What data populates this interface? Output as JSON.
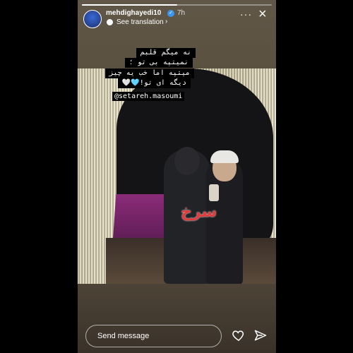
{
  "story": {
    "progress": 0.5,
    "username": "mehdighayedi10",
    "verified_mark": "✓",
    "time": "7h",
    "translation_label": "See translation",
    "translation_chevron": "›",
    "more_icon": "more-icon",
    "close_icon": "×"
  },
  "caption": {
    "lines": [
      "نه میگم قلبم",
      "نمیتپه بی تو ؛",
      "میتپه اما خب یه چیز",
      "دیگه ای تو!🩵🤍"
    ],
    "mention": "@setareh.masoumi"
  },
  "overlay": {
    "logo_text": "سرخ"
  },
  "footer": {
    "message_placeholder": "Send message",
    "heart_icon": "heart-icon",
    "send_icon": "send-icon"
  },
  "colors": {
    "background": "#000000",
    "verified": "#3897f0",
    "logo": "#e23b3b"
  }
}
